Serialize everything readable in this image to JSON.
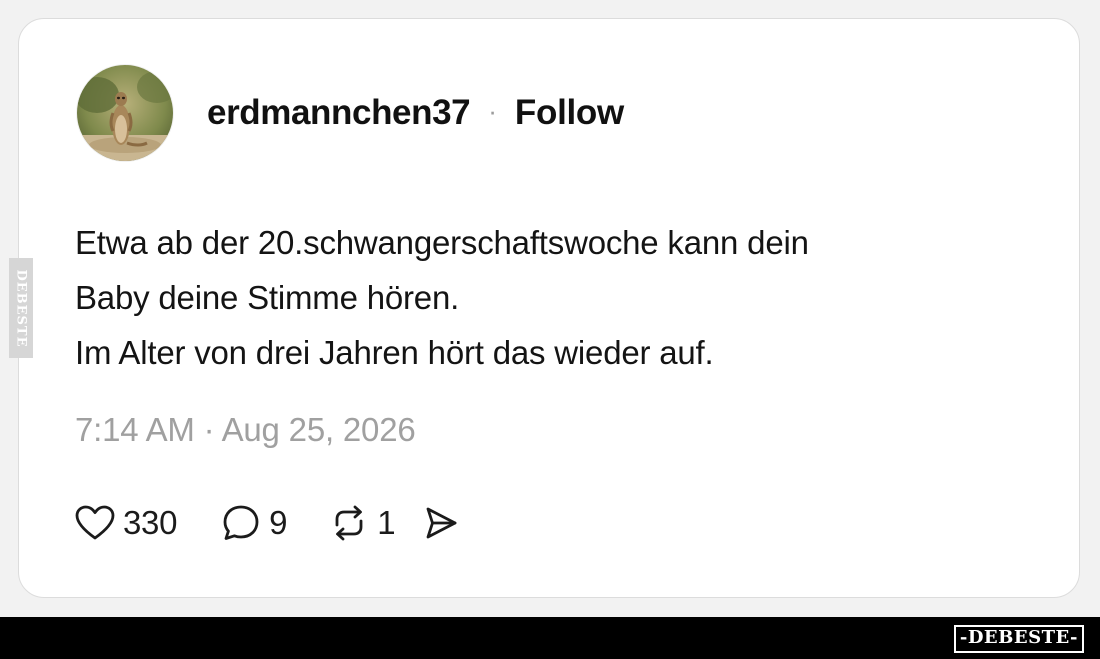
{
  "post": {
    "username": "erdmannchen37",
    "separator": "·",
    "follow_label": "Follow",
    "lines": [
      "Etwa ab der 20.schwangerschaftswoche kann dein",
      "Baby deine Stimme hören.",
      "Im Alter von drei Jahren hört das wieder auf."
    ],
    "timestamp": "7:14 AM · Aug 25, 2026",
    "actions": {
      "likes": "330",
      "replies": "9",
      "reposts": "1"
    }
  },
  "icons": {
    "like": "heart-icon",
    "reply": "speech-bubble-icon",
    "repost": "repost-arrows-icon",
    "share": "send-icon"
  },
  "watermark": {
    "side_text": "DEBESTE",
    "logo_text": "-DEBESTE-"
  },
  "colors": {
    "card_background": "#ffffff",
    "page_background": "#f2f2f2",
    "muted_text": "#a0a0a0",
    "footer_background": "#000000"
  }
}
